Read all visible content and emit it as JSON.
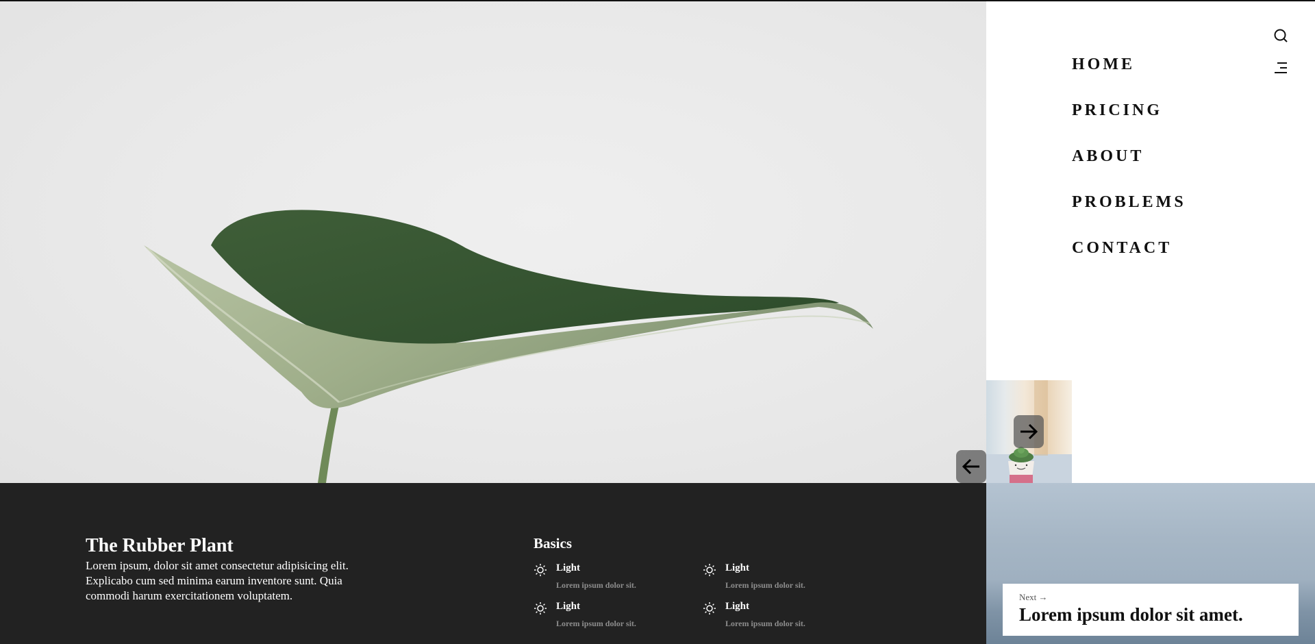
{
  "nav": {
    "items": [
      {
        "label": "HOME"
      },
      {
        "label": "PRICING"
      },
      {
        "label": "ABOUT"
      },
      {
        "label": "PROBLEMS"
      },
      {
        "label": "CONTACT"
      }
    ],
    "search_icon": "search-icon",
    "menu_icon": "menu-icon"
  },
  "hero": {
    "image": "green-leaf-photo"
  },
  "slider": {
    "thumbnail": "succulent-pot-photo",
    "next_icon": "arrow-right-icon",
    "prev_icon": "arrow-left-icon"
  },
  "footer": {
    "title": "The Rubber Plant",
    "description": "Lorem ipsum, dolor sit amet consectetur adipisicing elit. Explicabo cum sed minima earum inventore sunt. Quia commodi harum exercitationem voluptatem.",
    "basics": {
      "heading": "Basics",
      "features": [
        {
          "title": "Light",
          "desc": "Lorem ipsum dolor sit.",
          "icon": "sun-icon"
        },
        {
          "title": "Light",
          "desc": "Lorem ipsum dolor sit.",
          "icon": "sun-icon"
        },
        {
          "title": "Light",
          "desc": "Lorem ipsum dolor sit.",
          "icon": "sun-icon"
        },
        {
          "title": "Light",
          "desc": "Lorem ipsum dolor sit.",
          "icon": "sun-icon"
        }
      ]
    }
  },
  "next_post": {
    "label": "Next",
    "title": "Lorem ipsum dolor sit amet."
  },
  "colors": {
    "footer_bg": "#222222",
    "text_dark": "#111111",
    "muted": "#8d8d8d",
    "arrow_bg": "#5a5a5a"
  }
}
